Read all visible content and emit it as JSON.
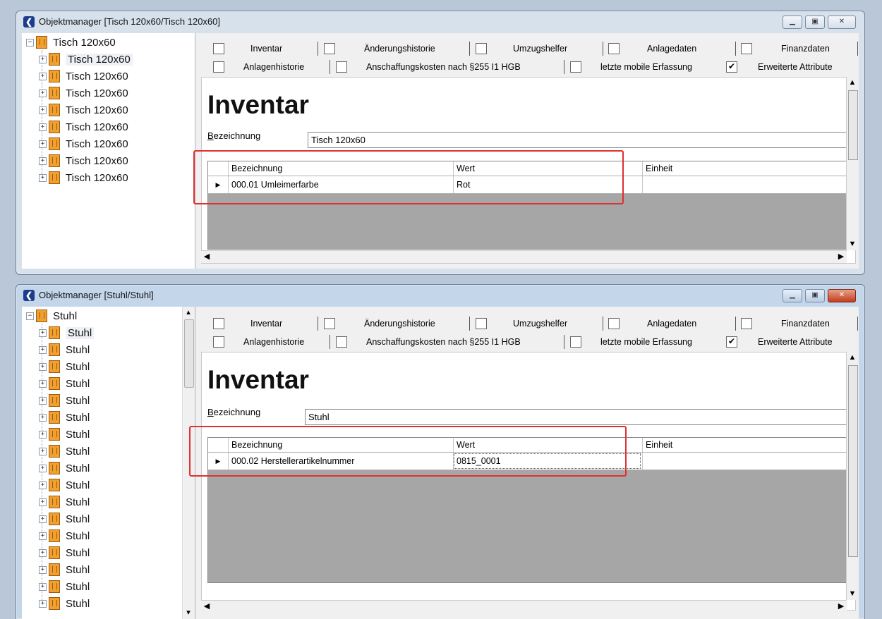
{
  "windows": [
    {
      "title": "Objektmanager [Tisch 120x60/Tisch 120x60]",
      "tree": {
        "root": "Tisch 120x60",
        "children": [
          "Tisch 120x60",
          "Tisch 120x60",
          "Tisch 120x60",
          "Tisch 120x60",
          "Tisch 120x60",
          "Tisch 120x60",
          "Tisch 120x60",
          "Tisch 120x60"
        ]
      },
      "tabs_row1": [
        {
          "label": "Inventar",
          "checked": false
        },
        {
          "label": "Änderungshistorie",
          "checked": false
        },
        {
          "label": "Umzugshelfer",
          "checked": false
        },
        {
          "label": "Anlagedaten",
          "checked": false
        },
        {
          "label": "Finanzdaten",
          "checked": false
        }
      ],
      "tabs_row2": [
        {
          "label": "Anlagenhistorie",
          "checked": false
        },
        {
          "label": "Anschaffungskosten nach §255 I1 HGB",
          "checked": false
        },
        {
          "label": "letzte mobile Erfassung",
          "checked": false
        },
        {
          "label": "Erweiterte Attribute",
          "checked": true
        }
      ],
      "heading": "Inventar",
      "bezeichnung_label": "Bezeichnung",
      "bezeichnung_value": "Tisch 120x60",
      "grid": {
        "columns": [
          "Bezeichnung",
          "Wert",
          "Einheit"
        ],
        "rows": [
          {
            "bezeichnung": "000.01 Umleimerfarbe",
            "wert": "Rot",
            "einheit": ""
          }
        ]
      }
    },
    {
      "title": "Objektmanager [Stuhl/Stuhl]",
      "tree": {
        "root": "Stuhl",
        "children": [
          "Stuhl",
          "Stuhl",
          "Stuhl",
          "Stuhl",
          "Stuhl",
          "Stuhl",
          "Stuhl",
          "Stuhl",
          "Stuhl",
          "Stuhl",
          "Stuhl",
          "Stuhl",
          "Stuhl",
          "Stuhl",
          "Stuhl",
          "Stuhl",
          "Stuhl"
        ]
      },
      "tabs_row1": [
        {
          "label": "Inventar",
          "checked": false
        },
        {
          "label": "Änderungshistorie",
          "checked": false
        },
        {
          "label": "Umzugshelfer",
          "checked": false
        },
        {
          "label": "Anlagedaten",
          "checked": false
        },
        {
          "label": "Finanzdaten",
          "checked": false
        }
      ],
      "tabs_row2": [
        {
          "label": "Anlagenhistorie",
          "checked": false
        },
        {
          "label": "Anschaffungskosten nach §255 I1 HGB",
          "checked": false
        },
        {
          "label": "letzte mobile Erfassung",
          "checked": false
        },
        {
          "label": "Erweiterte Attribute",
          "checked": true
        }
      ],
      "heading": "Inventar",
      "bezeichnung_label": "Bezeichnung",
      "bezeichnung_value": "Stuhl",
      "grid": {
        "columns": [
          "Bezeichnung",
          "Wert",
          "Einheit"
        ],
        "rows": [
          {
            "bezeichnung": "000.02 Herstellerartikelnummer",
            "wert": "0815_0001",
            "einheit": ""
          }
        ]
      }
    }
  ],
  "colors": {
    "highlight_box": "#e03030",
    "folder_icon": "#f0a030"
  },
  "icons": [
    "app-icon",
    "minimize-icon",
    "maximize-icon",
    "close-icon",
    "tree-expand-icon",
    "object-icon",
    "row-pointer-icon",
    "scroll-up-icon",
    "scroll-down-icon",
    "scroll-left-icon",
    "scroll-right-icon"
  ]
}
